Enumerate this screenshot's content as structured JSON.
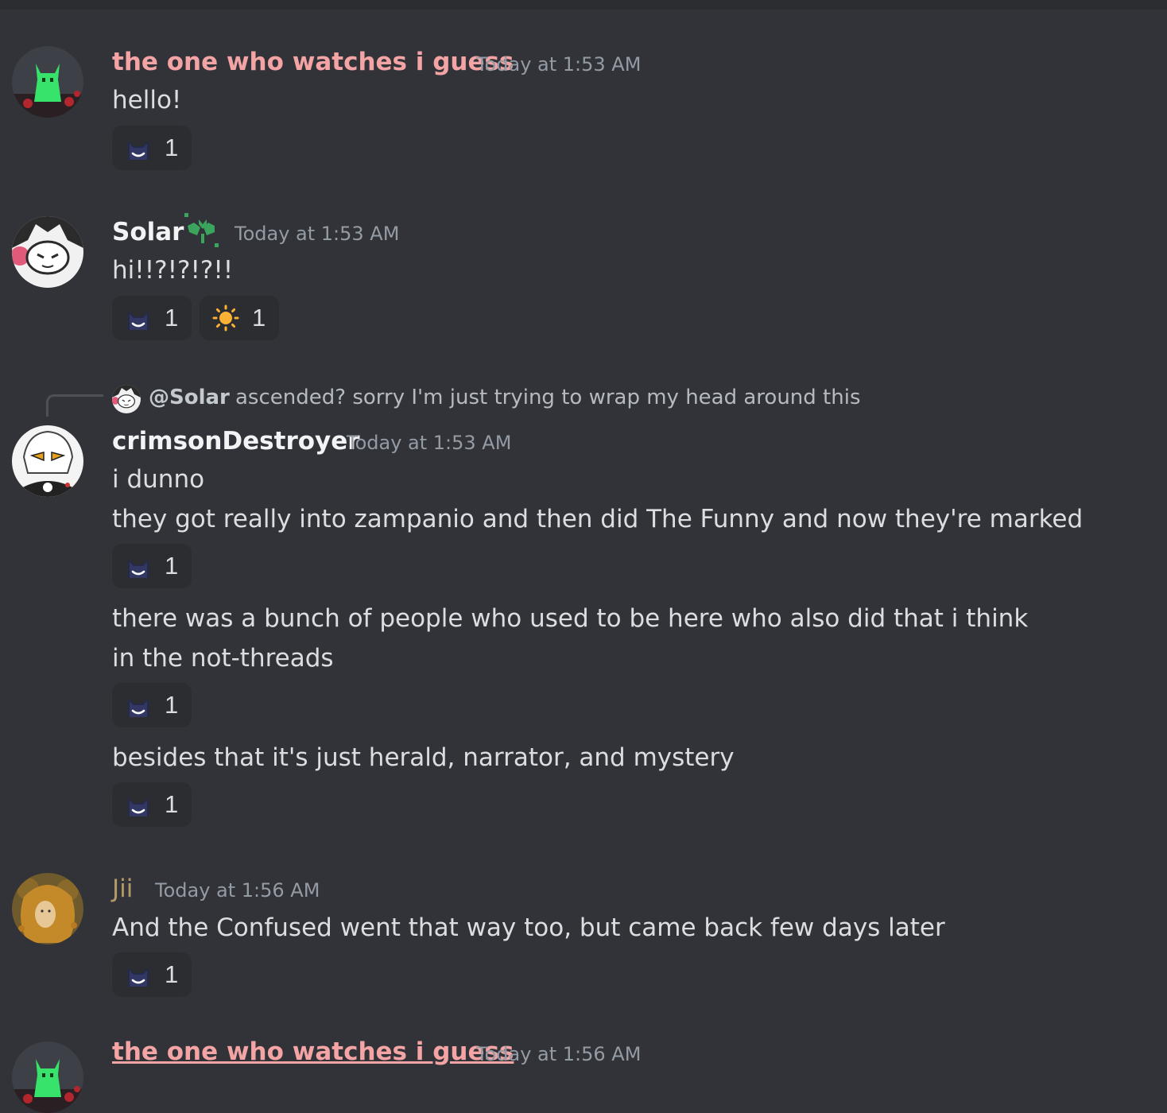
{
  "colors": {
    "background": "#313338",
    "name_pink": "#f4a4a4",
    "name_white": "#f2f3f5",
    "name_jii": "#b59968",
    "timestamp": "#949ba4",
    "message_text": "#dbdee1",
    "reaction_bg": "#2b2d31"
  },
  "messages": [
    {
      "author": "the one who watches i guess",
      "timestamp": "Today at 1:53 AM",
      "avatar_icon": "green-creature-avatar",
      "lines": [
        "hello!"
      ],
      "reactions": [
        {
          "emoji": "dark-cat-emoji",
          "count": "1"
        }
      ]
    },
    {
      "author": "Solar",
      "badge_icon": "green-sprout-badge-icon",
      "timestamp": "Today at 1:53 AM",
      "avatar_icon": "white-cat-mask-avatar",
      "lines": [
        "hi!!?!?!?!!"
      ],
      "reactions": [
        {
          "emoji": "dark-cat-emoji",
          "count": "1"
        },
        {
          "emoji": "sun-emoji",
          "count": "1"
        }
      ]
    },
    {
      "reply": {
        "author": "@Solar",
        "text": "ascended? sorry I'm just trying to wrap my head around this"
      },
      "author": "crimsonDestroyer",
      "timestamp": "Today at 1:53 AM",
      "avatar_icon": "white-haired-character-avatar",
      "lines": [
        "i dunno",
        "they got really into zampanio and then did The Funny and now they're marked",
        "there was a bunch of people who used to be here who also did that i think",
        "in the not-threads",
        "besides that it's just herald, narrator, and mystery"
      ],
      "reactions": [
        {
          "emoji": "dark-cat-emoji",
          "count": "1"
        },
        {
          "emoji": "dark-cat-emoji",
          "count": "1"
        },
        {
          "emoji": "dark-cat-emoji",
          "count": "1"
        }
      ]
    },
    {
      "author": "Jii",
      "timestamp": "Today at 1:56 AM",
      "avatar_icon": "golden-haired-portrait-avatar",
      "lines": [
        "And the Confused went that way too, but came back few days later"
      ],
      "reactions": [
        {
          "emoji": "dark-cat-emoji",
          "count": "1"
        }
      ]
    },
    {
      "author": "the one who watches i guess",
      "timestamp": "Today at 1:56 AM",
      "avatar_icon": "green-creature-avatar",
      "lines": [],
      "reactions": []
    }
  ]
}
